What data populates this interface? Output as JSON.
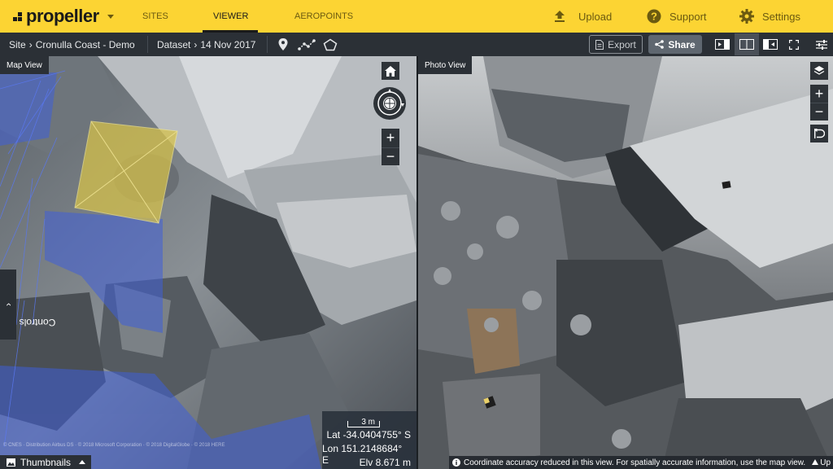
{
  "topbar": {
    "logo": "propeller",
    "nav": [
      "SITES",
      "VIEWER",
      "AEROPOINTS"
    ],
    "active_nav": "VIEWER",
    "upload": "Upload",
    "support": "Support",
    "settings": "Settings"
  },
  "subbar": {
    "site_prefix": "Site",
    "site": "Cronulla Coast - Demo",
    "dataset_prefix": "Dataset",
    "dataset": "14 Nov 2017",
    "export": "Export",
    "share": "Share"
  },
  "map_view": {
    "label": "Map View",
    "controls_tab": "Controls",
    "scale_label": "3 m",
    "lat": "Lat -34.0404755° S",
    "lon": "Lon 151.2148684° E",
    "elv": "Elv 8.671 m",
    "thumbnails": "Thumbnails",
    "attribution": "© CNES · Distribution Airbus DS · © 2018 Microsoft Corporation · © 2018 DigitalGlobe · © 2018 HERE"
  },
  "photo_view": {
    "label": "Photo View",
    "notice": "Coordinate accuracy reduced in this view. For spatially accurate information, use the map view.",
    "up": "Up"
  },
  "colors": {
    "brand_yellow": "#fcd433",
    "toolbar_dark": "#2b3036",
    "camera_blue": "#4f6de0"
  },
  "icons": [
    "caret-down-icon",
    "upload-icon",
    "help-icon",
    "gear-icon",
    "pin-icon",
    "polyline-icon",
    "polygon-icon",
    "export-doc-icon",
    "share-icon",
    "view-map-only-icon",
    "view-split-icon",
    "view-photo-only-icon",
    "fullscreen-icon",
    "sliders-icon",
    "home-icon",
    "compass-icon",
    "zoom-in-icon",
    "zoom-out-icon",
    "layers-icon",
    "reset-icon",
    "chevron-right-icon",
    "image-icon",
    "info-icon",
    "arrow-up-icon"
  ]
}
